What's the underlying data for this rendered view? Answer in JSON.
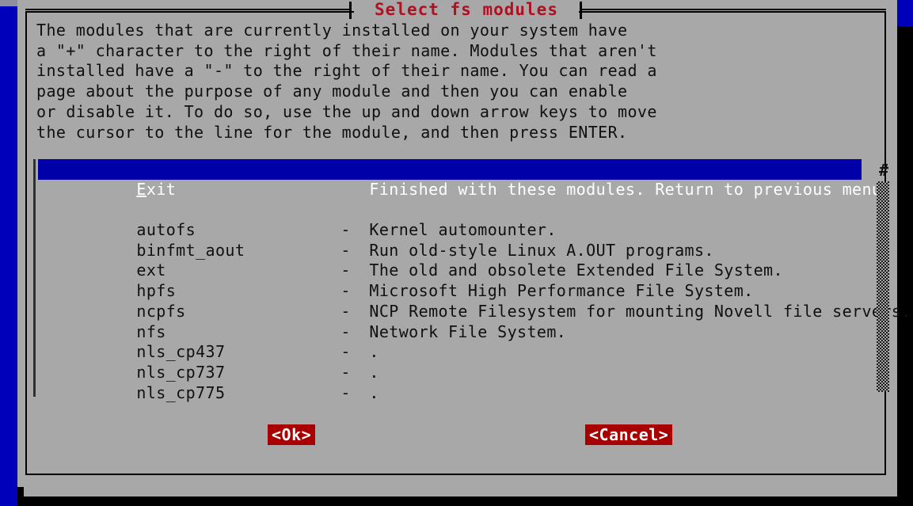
{
  "dialog": {
    "title": "Select fs modules",
    "description": "The modules that are currently installed on your system have\na \"+\" character to the right of their name. Modules that aren't\ninstalled have a \"-\" to the right of their name. You can read a\npage about the purpose of any module and then you can enable\nor disable it. To do so, use the up and down arrow keys to move\nthe cursor to the line for the module, and then press ENTER."
  },
  "list": {
    "selected": {
      "name_hotkey": "E",
      "name_rest": "xit",
      "separator": "",
      "description": "Finished with these modules. Return to previous menu."
    },
    "items": [
      {
        "name": "autofs",
        "separator": "-",
        "description": "Kernel automounter."
      },
      {
        "name": "binfmt_aout",
        "separator": "-",
        "description": "Run old-style Linux A.OUT programs."
      },
      {
        "name": "ext",
        "separator": "-",
        "description": "The old and obsolete Extended File System."
      },
      {
        "name": "hpfs",
        "separator": "-",
        "description": "Microsoft High Performance File System."
      },
      {
        "name": "ncpfs",
        "separator": "-",
        "description": "NCP Remote Filesystem for mounting Novell file servers."
      },
      {
        "name": "nfs",
        "separator": "-",
        "description": "Network File System."
      },
      {
        "name": "nls_cp437",
        "separator": "-",
        "description": "."
      },
      {
        "name": "nls_cp737",
        "separator": "-",
        "description": "."
      },
      {
        "name": "nls_cp775",
        "separator": "-",
        "description": "."
      }
    ]
  },
  "scrollbar": {
    "marker": "#"
  },
  "buttons": {
    "ok": "<Ok>",
    "cancel": "<Cancel>"
  },
  "colors": {
    "dialog_background": "#a8a8a8",
    "title_red": "#b01020",
    "highlight_blue": "#0000a8",
    "button_red": "#a80000",
    "text_black": "#101010",
    "desktop_blue": "#0000bb",
    "screen_black": "#000000"
  }
}
